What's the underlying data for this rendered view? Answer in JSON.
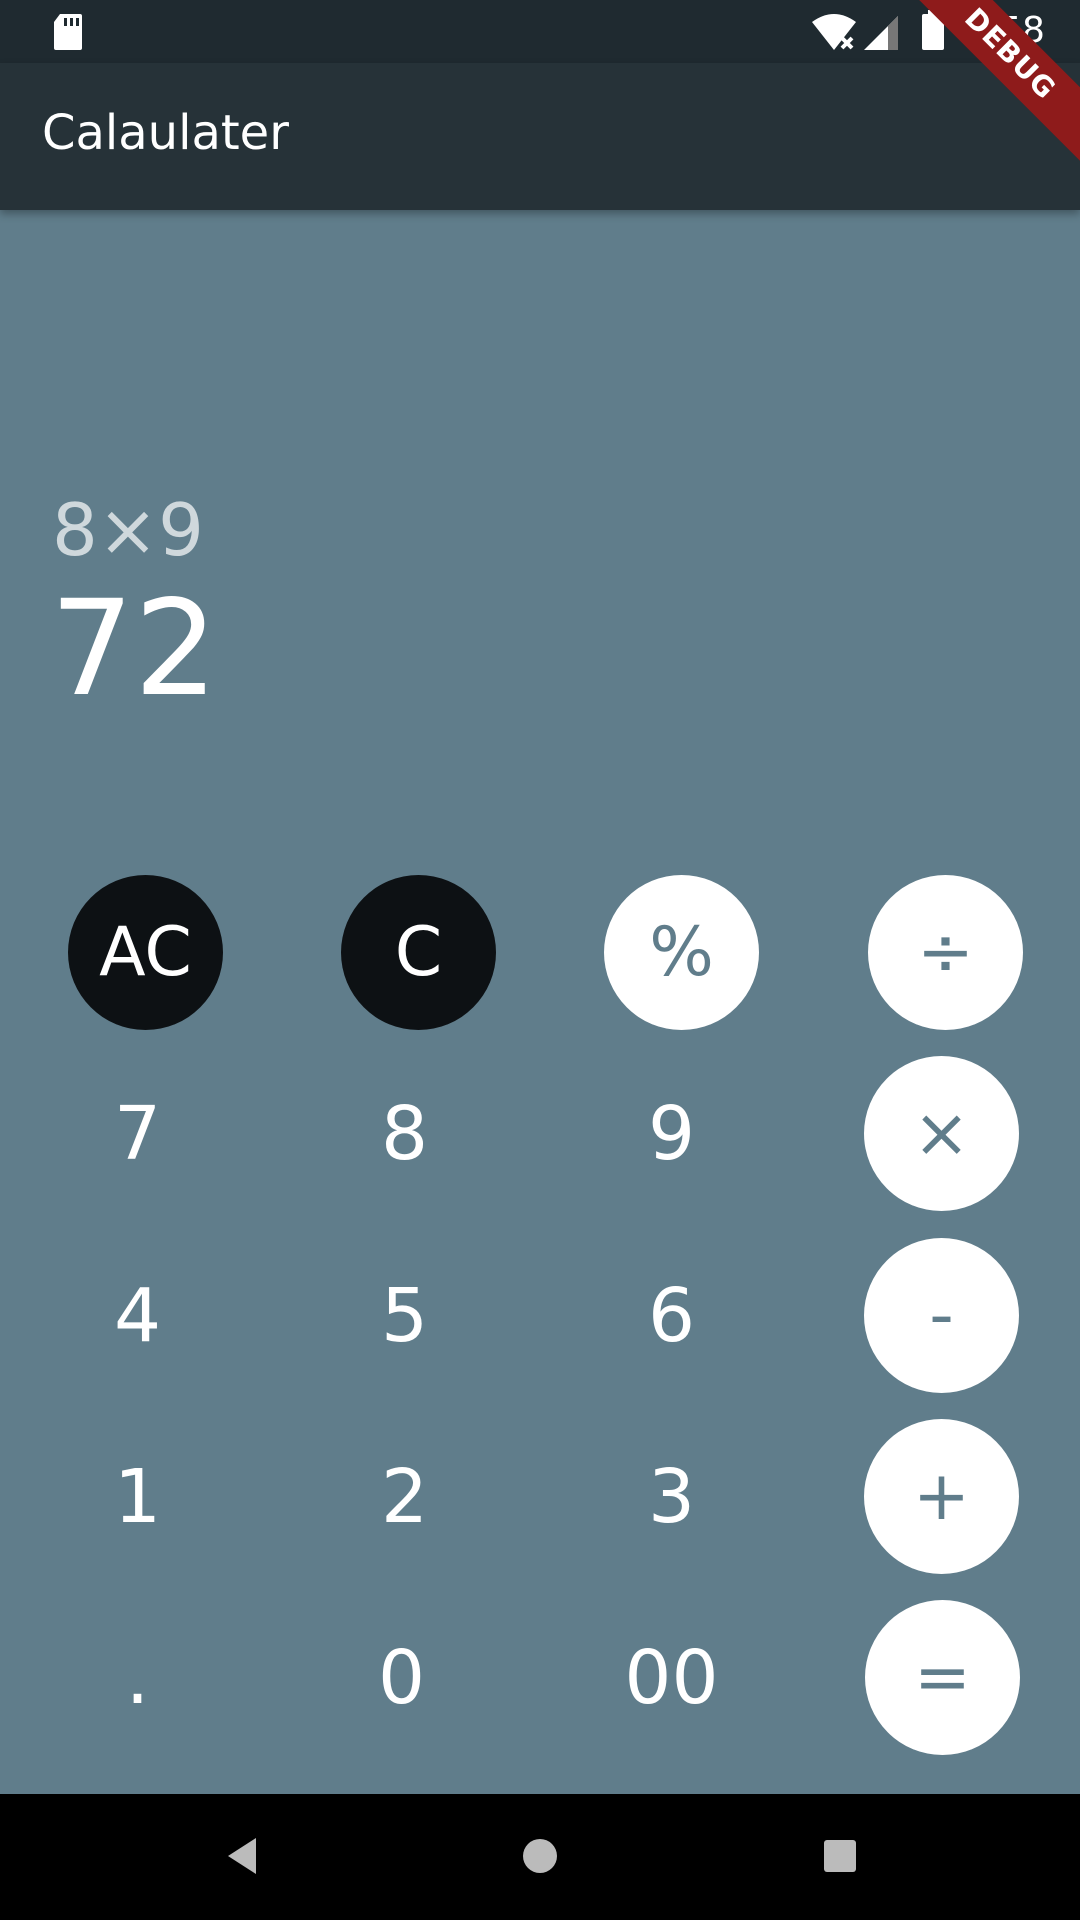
{
  "status_bar": {
    "time": "1:58",
    "icons": [
      "sd-card-icon",
      "wifi-icon",
      "signal-icon",
      "battery-icon"
    ]
  },
  "app_bar": {
    "title": "Calaulater",
    "debug_label": "DEBUG"
  },
  "display": {
    "expression": "8×9",
    "result": "72"
  },
  "keypad": {
    "ac": "AC",
    "c": "C",
    "percent": "%",
    "divide": "÷",
    "seven": "7",
    "eight": "8",
    "nine": "9",
    "multiply": "×",
    "four": "4",
    "five": "5",
    "six": "6",
    "minus": "-",
    "one": "1",
    "two": "2",
    "three": "3",
    "plus": "+",
    "dot": ".",
    "zero": "0",
    "double_zero": "00",
    "equals": "="
  },
  "nav_bar": {
    "icons": [
      "back-icon",
      "home-icon",
      "recents-icon"
    ]
  },
  "colors": {
    "background": "#607d8b",
    "app_bar": "#263238",
    "dark_button": "#0d1114",
    "light_button": "#ffffff"
  }
}
